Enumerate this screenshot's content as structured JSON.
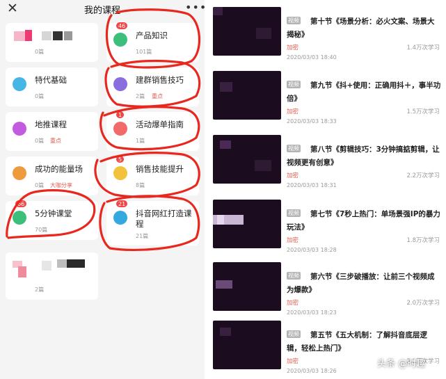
{
  "header": {
    "close_icon": "close-icon",
    "title": "我的课程",
    "more_icon": "more-icon"
  },
  "courses": [
    {
      "name": "",
      "count": "0篇",
      "tag": "",
      "badge": "",
      "icon_color": ""
    },
    {
      "name": "产品知识",
      "count": "101篇",
      "tag": "",
      "badge": "46",
      "icon_color": "#3cbf7a"
    },
    {
      "name": "特代基础",
      "count": "0篇",
      "tag": "",
      "badge": "",
      "icon_color": "#45b6e6"
    },
    {
      "name": "建群销售技巧",
      "count": "2篇",
      "tag": "重点",
      "badge": "",
      "icon_color": "#8a6ee0"
    },
    {
      "name": "地推课程",
      "count": "0篇",
      "tag": "重点",
      "badge": "",
      "icon_color": "#c25be0"
    },
    {
      "name": "活动爆单指南",
      "count": "1篇",
      "tag": "",
      "badge": "1",
      "icon_color": "#f26a6a"
    },
    {
      "name": "成功的能量场",
      "count": "0篇",
      "tag": "大咖分享",
      "badge": "",
      "icon_color": "#f09a3e"
    },
    {
      "name": "销售技能提升",
      "count": "8篇",
      "tag": "",
      "badge": "5",
      "icon_color": "#f2c23a"
    },
    {
      "name": "5分钟课堂",
      "count": "70篇",
      "tag": "",
      "badge": "66",
      "icon_color": "#3cbf7a"
    },
    {
      "name": "抖音网红打造课程",
      "count": "21篇",
      "tag": "",
      "badge": "21",
      "icon_color": "#33a9e0"
    },
    {
      "name": "",
      "count": "2篇",
      "tag": "",
      "badge": "",
      "icon_color": ""
    }
  ],
  "lessons": [
    {
      "badge": "视频",
      "title": "第十节《场景分析：必火文案、场景大揭秘》",
      "lock": "加密",
      "views": "1.4万次学习",
      "time": "2020/03/03 18:40"
    },
    {
      "badge": "视频",
      "title": "第九节《抖+使用：正确用抖＋，事半功倍》",
      "lock": "加密",
      "views": "1.5万次学习",
      "time": "2020/03/03 18:33"
    },
    {
      "badge": "视频",
      "title": "第八节《剪辑技巧：3分钟搞掂剪辑，让视频更有创意》",
      "lock": "加密",
      "views": "2.2万次学习",
      "time": "2020/03/03 18:31"
    },
    {
      "badge": "视频",
      "title": "第七节《7秒上热门：单场景强IP的暴力玩法》",
      "lock": "加密",
      "views": "1.8万次学习",
      "time": "2020/03/03 18:28"
    },
    {
      "badge": "视频",
      "title": "第六节《三步破播放：让前三个视频成为爆款》",
      "lock": "加密",
      "views": "2.0万次学习",
      "time": "2020/03/03 18:23"
    },
    {
      "badge": "视频",
      "title": "第五节《五大机制：了解抖音底层逻辑，轻松上热门》",
      "lock": "加密",
      "views": "2.1万次学习",
      "time": "2020/03/03 18:26"
    }
  ],
  "watermark": "头条 @时趣",
  "colors": {
    "accent": "#e35c4d",
    "scribble": "#e8271f",
    "thumb": "#1b0d1f"
  }
}
